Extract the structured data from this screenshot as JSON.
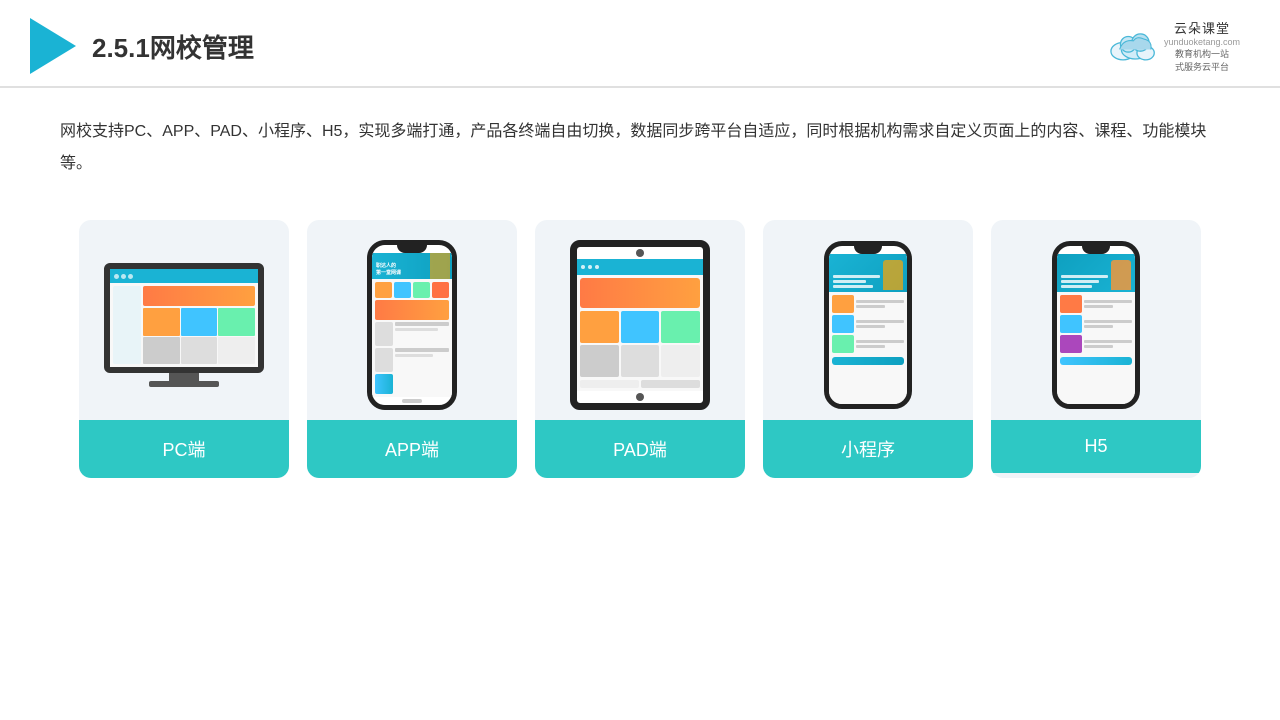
{
  "header": {
    "title": "2.5.1网校管理",
    "brand": {
      "name": "云朵课堂",
      "url": "yunduoketang.com",
      "tagline": "教育机构一站\n式服务云平台"
    }
  },
  "description": "网校支持PC、APP、PAD、小程序、H5，实现多端打通，产品各终端自由切换，数据同步跨平台自适应，同时根据机构需求自定义页面上的内容、课程、功能模块等。",
  "cards": [
    {
      "id": "pc",
      "label": "PC端"
    },
    {
      "id": "app",
      "label": "APP端"
    },
    {
      "id": "pad",
      "label": "PAD端"
    },
    {
      "id": "miniapp",
      "label": "小程序"
    },
    {
      "id": "h5",
      "label": "H5"
    }
  ]
}
